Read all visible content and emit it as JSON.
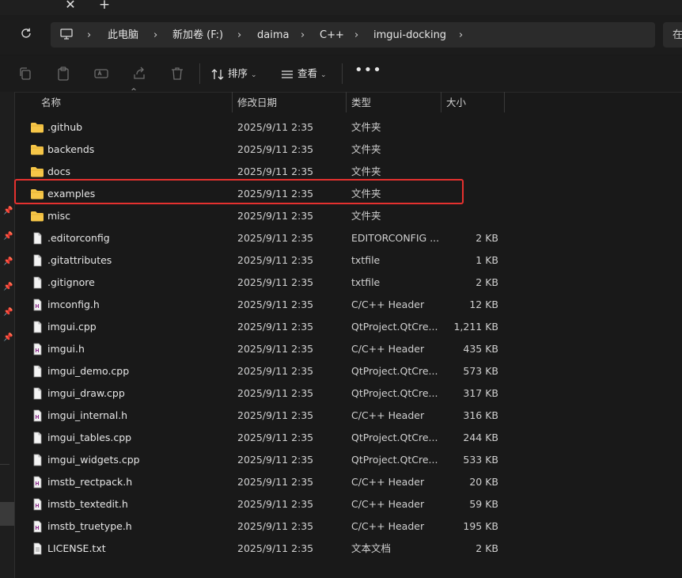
{
  "tabs": {
    "close_glyph": "✕",
    "new_glyph": "+"
  },
  "address": {
    "breadcrumbs": [
      "此电脑",
      "新加卷 (F:)",
      "daima",
      "C++",
      "imgui-docking"
    ],
    "search_text": "在"
  },
  "toolbar": {
    "sort_label": "排序",
    "view_label": "查看",
    "more_label": "•••",
    "icons": [
      "copy-icon",
      "paste-icon",
      "rename-icon",
      "share-icon",
      "delete-icon"
    ]
  },
  "columns": {
    "name": "名称",
    "date": "修改日期",
    "type": "类型",
    "size": "大小"
  },
  "colors": {
    "folder": "#f6c648",
    "highlight": "#e5312f",
    "background": "#191919"
  },
  "files": [
    {
      "name": ".github",
      "date": "2025/9/11 2:35",
      "type": "文件夹",
      "size": "",
      "icon": "folder-icon"
    },
    {
      "name": "backends",
      "date": "2025/9/11 2:35",
      "type": "文件夹",
      "size": "",
      "icon": "folder-icon"
    },
    {
      "name": "docs",
      "date": "2025/9/11 2:35",
      "type": "文件夹",
      "size": "",
      "icon": "folder-icon"
    },
    {
      "name": "examples",
      "date": "2025/9/11 2:35",
      "type": "文件夹",
      "size": "",
      "icon": "folder-icon"
    },
    {
      "name": "misc",
      "date": "2025/9/11 2:35",
      "type": "文件夹",
      "size": "",
      "icon": "folder-icon"
    },
    {
      "name": ".editorconfig",
      "date": "2025/9/11 2:35",
      "type": "EDITORCONFIG ...",
      "size": "2 KB",
      "icon": "file-icon"
    },
    {
      "name": ".gitattributes",
      "date": "2025/9/11 2:35",
      "type": "txtfile",
      "size": "1 KB",
      "icon": "file-icon"
    },
    {
      "name": ".gitignore",
      "date": "2025/9/11 2:35",
      "type": "txtfile",
      "size": "2 KB",
      "icon": "file-icon"
    },
    {
      "name": "imconfig.h",
      "date": "2025/9/11 2:35",
      "type": "C/C++ Header",
      "size": "12 KB",
      "icon": "header-file-icon"
    },
    {
      "name": "imgui.cpp",
      "date": "2025/9/11 2:35",
      "type": "QtProject.QtCre...",
      "size": "1,211 KB",
      "icon": "file-icon"
    },
    {
      "name": "imgui.h",
      "date": "2025/9/11 2:35",
      "type": "C/C++ Header",
      "size": "435 KB",
      "icon": "header-file-icon"
    },
    {
      "name": "imgui_demo.cpp",
      "date": "2025/9/11 2:35",
      "type": "QtProject.QtCre...",
      "size": "573 KB",
      "icon": "file-icon"
    },
    {
      "name": "imgui_draw.cpp",
      "date": "2025/9/11 2:35",
      "type": "QtProject.QtCre...",
      "size": "317 KB",
      "icon": "file-icon"
    },
    {
      "name": "imgui_internal.h",
      "date": "2025/9/11 2:35",
      "type": "C/C++ Header",
      "size": "316 KB",
      "icon": "header-file-icon"
    },
    {
      "name": "imgui_tables.cpp",
      "date": "2025/9/11 2:35",
      "type": "QtProject.QtCre...",
      "size": "244 KB",
      "icon": "file-icon"
    },
    {
      "name": "imgui_widgets.cpp",
      "date": "2025/9/11 2:35",
      "type": "QtProject.QtCre...",
      "size": "533 KB",
      "icon": "file-icon"
    },
    {
      "name": "imstb_rectpack.h",
      "date": "2025/9/11 2:35",
      "type": "C/C++ Header",
      "size": "20 KB",
      "icon": "header-file-icon"
    },
    {
      "name": "imstb_textedit.h",
      "date": "2025/9/11 2:35",
      "type": "C/C++ Header",
      "size": "59 KB",
      "icon": "header-file-icon"
    },
    {
      "name": "imstb_truetype.h",
      "date": "2025/9/11 2:35",
      "type": "C/C++ Header",
      "size": "195 KB",
      "icon": "header-file-icon"
    },
    {
      "name": "LICENSE.txt",
      "date": "2025/9/11 2:35",
      "type": "文本文档",
      "size": "2 KB",
      "icon": "text-file-icon"
    }
  ]
}
